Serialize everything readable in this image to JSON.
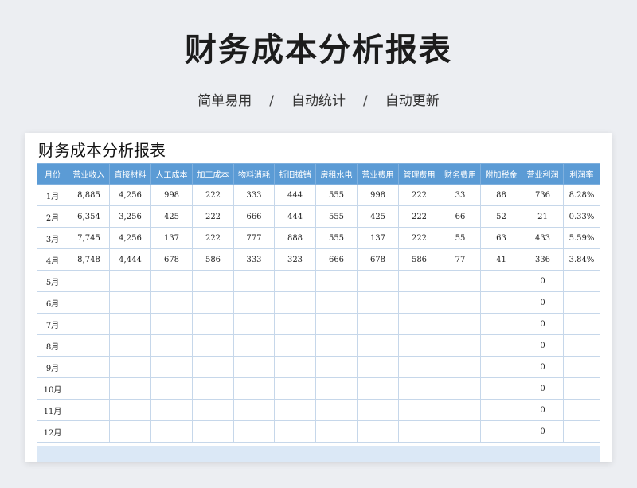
{
  "hero": {
    "title": "财务成本分析报表",
    "subtitle": [
      "简单易用",
      "自动统计",
      "自动更新"
    ],
    "separator": "/"
  },
  "sheet": {
    "title": "财务成本分析报表",
    "headers": [
      "月份",
      "营业收入",
      "直接材料",
      "人工成本",
      "加工成本",
      "物料消耗",
      "折旧摊销",
      "房租水电",
      "营业费用",
      "管理费用",
      "财务费用",
      "附加税金",
      "营业利润",
      "利润率"
    ],
    "rows": [
      [
        "1月",
        "8,885",
        "4,256",
        "998",
        "222",
        "333",
        "444",
        "555",
        "998",
        "222",
        "33",
        "88",
        "736",
        "8.28%"
      ],
      [
        "2月",
        "6,354",
        "3,256",
        "425",
        "222",
        "666",
        "444",
        "555",
        "425",
        "222",
        "66",
        "52",
        "21",
        "0.33%"
      ],
      [
        "3月",
        "7,745",
        "4,256",
        "137",
        "222",
        "777",
        "888",
        "555",
        "137",
        "222",
        "55",
        "63",
        "433",
        "5.59%"
      ],
      [
        "4月",
        "8,748",
        "4,444",
        "678",
        "586",
        "333",
        "323",
        "666",
        "678",
        "586",
        "77",
        "41",
        "336",
        "3.84%"
      ],
      [
        "5月",
        "",
        "",
        "",
        "",
        "",
        "",
        "",
        "",
        "",
        "",
        "",
        "0",
        ""
      ],
      [
        "6月",
        "",
        "",
        "",
        "",
        "",
        "",
        "",
        "",
        "",
        "",
        "",
        "0",
        ""
      ],
      [
        "7月",
        "",
        "",
        "",
        "",
        "",
        "",
        "",
        "",
        "",
        "",
        "",
        "0",
        ""
      ],
      [
        "8月",
        "",
        "",
        "",
        "",
        "",
        "",
        "",
        "",
        "",
        "",
        "",
        "0",
        ""
      ],
      [
        "9月",
        "",
        "",
        "",
        "",
        "",
        "",
        "",
        "",
        "",
        "",
        "",
        "0",
        ""
      ],
      [
        "10月",
        "",
        "",
        "",
        "",
        "",
        "",
        "",
        "",
        "",
        "",
        "",
        "0",
        ""
      ],
      [
        "11月",
        "",
        "",
        "",
        "",
        "",
        "",
        "",
        "",
        "",
        "",
        "",
        "0",
        ""
      ],
      [
        "12月",
        "",
        "",
        "",
        "",
        "",
        "",
        "",
        "",
        "",
        "",
        "",
        "0",
        ""
      ]
    ]
  }
}
